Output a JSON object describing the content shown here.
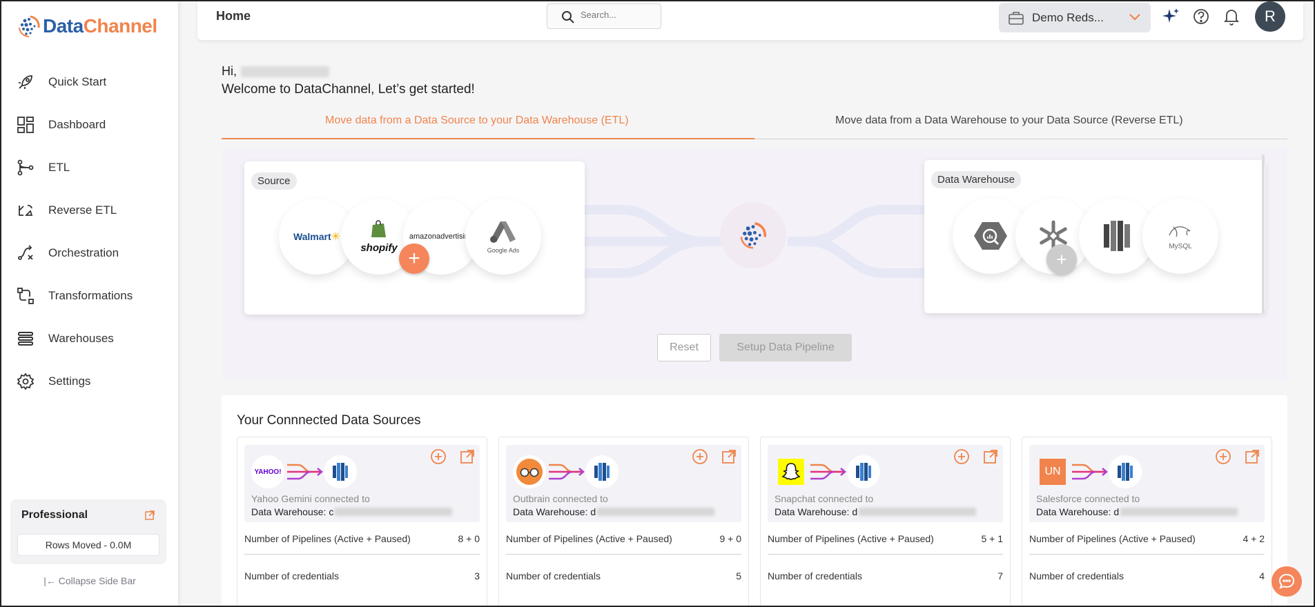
{
  "app": {
    "brand_part1": "Data",
    "brand_part2": "Channel"
  },
  "sidebar": {
    "items": [
      {
        "label": "Quick Start",
        "icon": "rocket-icon"
      },
      {
        "label": "Dashboard",
        "icon": "dashboard-icon"
      },
      {
        "label": "ETL",
        "icon": "etl-icon"
      },
      {
        "label": "Reverse ETL",
        "icon": "reverse-etl-icon"
      },
      {
        "label": "Orchestration",
        "icon": "orchestration-icon"
      },
      {
        "label": "Transformations",
        "icon": "transformations-icon"
      },
      {
        "label": "Warehouses",
        "icon": "warehouses-icon"
      },
      {
        "label": "Settings",
        "icon": "gear-icon"
      }
    ],
    "plan": {
      "title": "Professional",
      "rows_moved": "Rows Moved - 0.0M"
    },
    "collapse_label": "Collapse Side Bar"
  },
  "header": {
    "title": "Home",
    "search_placeholder": "Search...",
    "workspace": "Demo Reds...",
    "avatar_initial": "R"
  },
  "main": {
    "greeting": "Hi,",
    "welcome": "Welcome to DataChannel, Let’s get started!",
    "tabs": [
      {
        "label": "Move data from a Data Source to your Data Warehouse (ETL)",
        "active": true
      },
      {
        "label": "Move data from a Data Warehouse to your Data Source (Reverse ETL)",
        "active": false
      }
    ],
    "flow": {
      "source_label": "Source",
      "warehouse_label": "Data Warehouse",
      "source_logos": [
        "Walmart",
        "shopify",
        "amazon advertising",
        "Google Ads"
      ],
      "warehouse_logos": [
        "BigQuery",
        "Snowflake",
        "Redshift",
        "MySQL"
      ],
      "reset_label": "Reset",
      "setup_label": "Setup Data Pipeline"
    },
    "connected": {
      "title": "Your Connnected Data Sources",
      "pipelines_label": "Number of Pipelines (Active + Paused)",
      "credentials_label": "Number of credentials",
      "dw_prefix": "Data Warehouse:",
      "cards": [
        {
          "source": "Yahoo Gemini",
          "connected_text": "Yahoo Gemini connected to",
          "dw_char": "c",
          "pipelines": "8 + 0",
          "credentials": "3"
        },
        {
          "source": "Outbrain",
          "connected_text": "Outbrain connected to",
          "dw_char": "d",
          "pipelines": "9 + 0",
          "credentials": "5"
        },
        {
          "source": "Snapchat",
          "connected_text": "Snapchat connected to",
          "dw_char": "d",
          "pipelines": "5 + 1",
          "credentials": "7"
        },
        {
          "source": "Salesforce",
          "connected_text": "Salesforce connected to",
          "dw_char": "d",
          "pipelines": "4 + 2",
          "credentials": "4"
        }
      ]
    }
  },
  "logo_text": {
    "yahoo": "YAHOO!",
    "salesforce": "UN",
    "mysql": "MySQL",
    "walmart": "Walmart",
    "shopify": "shopify",
    "amazon": "amazonadvertising",
    "google_ads": "Google Ads"
  },
  "colors": {
    "accent": "#f0844c",
    "brand_blue": "#2c5fa8",
    "avatar": "#3d4a55",
    "redshift": "#2e6fb5"
  }
}
